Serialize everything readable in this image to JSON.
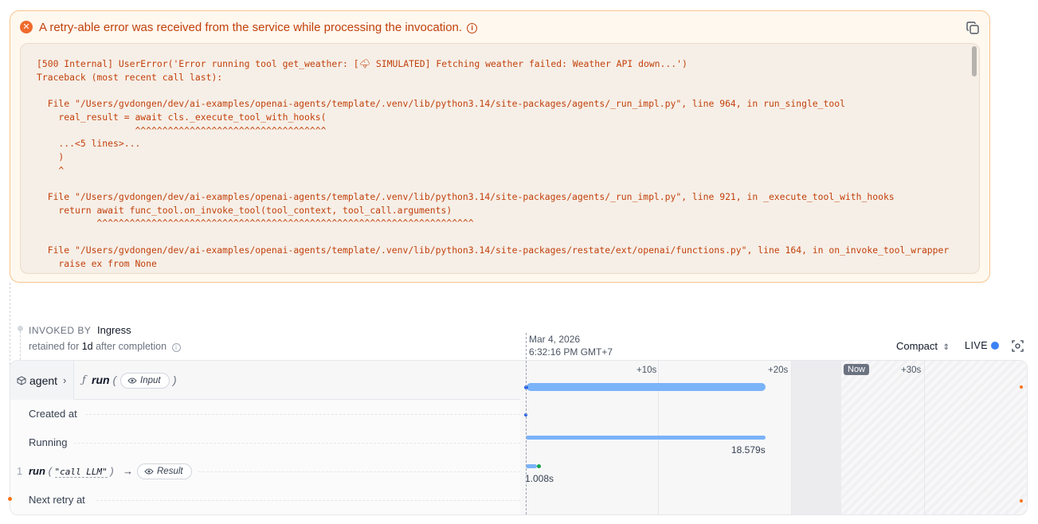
{
  "error": {
    "title": "A retry-able error was received from the service while processing the invocation.",
    "trace": "[500 Internal] UserError('Error running tool get_weather: [🌩 SIMULATED] Fetching weather failed: Weather API down...')\nTraceback (most recent call last):\n\n  File \"/Users/gvdongen/dev/ai-examples/openai-agents/template/.venv/lib/python3.14/site-packages/agents/_run_impl.py\", line 964, in run_single_tool\n    real_result = await cls._execute_tool_with_hooks(\n                  ^^^^^^^^^^^^^^^^^^^^^^^^^^^^^^^^^^^\n    ...<5 lines>...\n    )\n    ^\n\n  File \"/Users/gvdongen/dev/ai-examples/openai-agents/template/.venv/lib/python3.14/site-packages/agents/_run_impl.py\", line 921, in _execute_tool_with_hooks\n    return await func_tool.on_invoke_tool(tool_context, tool_call.arguments)\n           ^^^^^^^^^^^^^^^^^^^^^^^^^^^^^^^^^^^^^^^^^^^^^^^^^^^^^^^^^^^^^^^^^^^^^\n\n  File \"/Users/gvdongen/dev/ai-examples/openai-agents/template/.venv/lib/python3.14/site-packages/restate/ext/openai/functions.py\", line 164, in on_invoke_tool_wrapper\n    raise ex from None",
    "accent": "#c2410c"
  },
  "invocation": {
    "invoked_by_label": "INVOKED BY",
    "invoked_by": "Ingress",
    "retained_prefix": "retained for",
    "retained_value": "1d",
    "retained_suffix": "after completion"
  },
  "timestamp": {
    "date": "Mar 4, 2026",
    "time": "6:32:16 PM GMT+7"
  },
  "controls": {
    "compact": "Compact",
    "live": "LIVE"
  },
  "header": {
    "service": "agent",
    "function": "run",
    "paren_open": "(",
    "paren_close": ")",
    "input_pill": "Input"
  },
  "rows": {
    "created_at": "Created at",
    "running": "Running",
    "index": "1",
    "run_name": "run",
    "run_arg": "\"call LLM\"",
    "result_pill": "Result",
    "next_retry": "Next retry at"
  },
  "timeline": {
    "ticks": [
      "+10s",
      "+20s",
      "+30s"
    ],
    "now_label": "Now",
    "running_duration": "18.579s",
    "run_duration": "1.008s",
    "bar_color": "#7ab3f8"
  }
}
